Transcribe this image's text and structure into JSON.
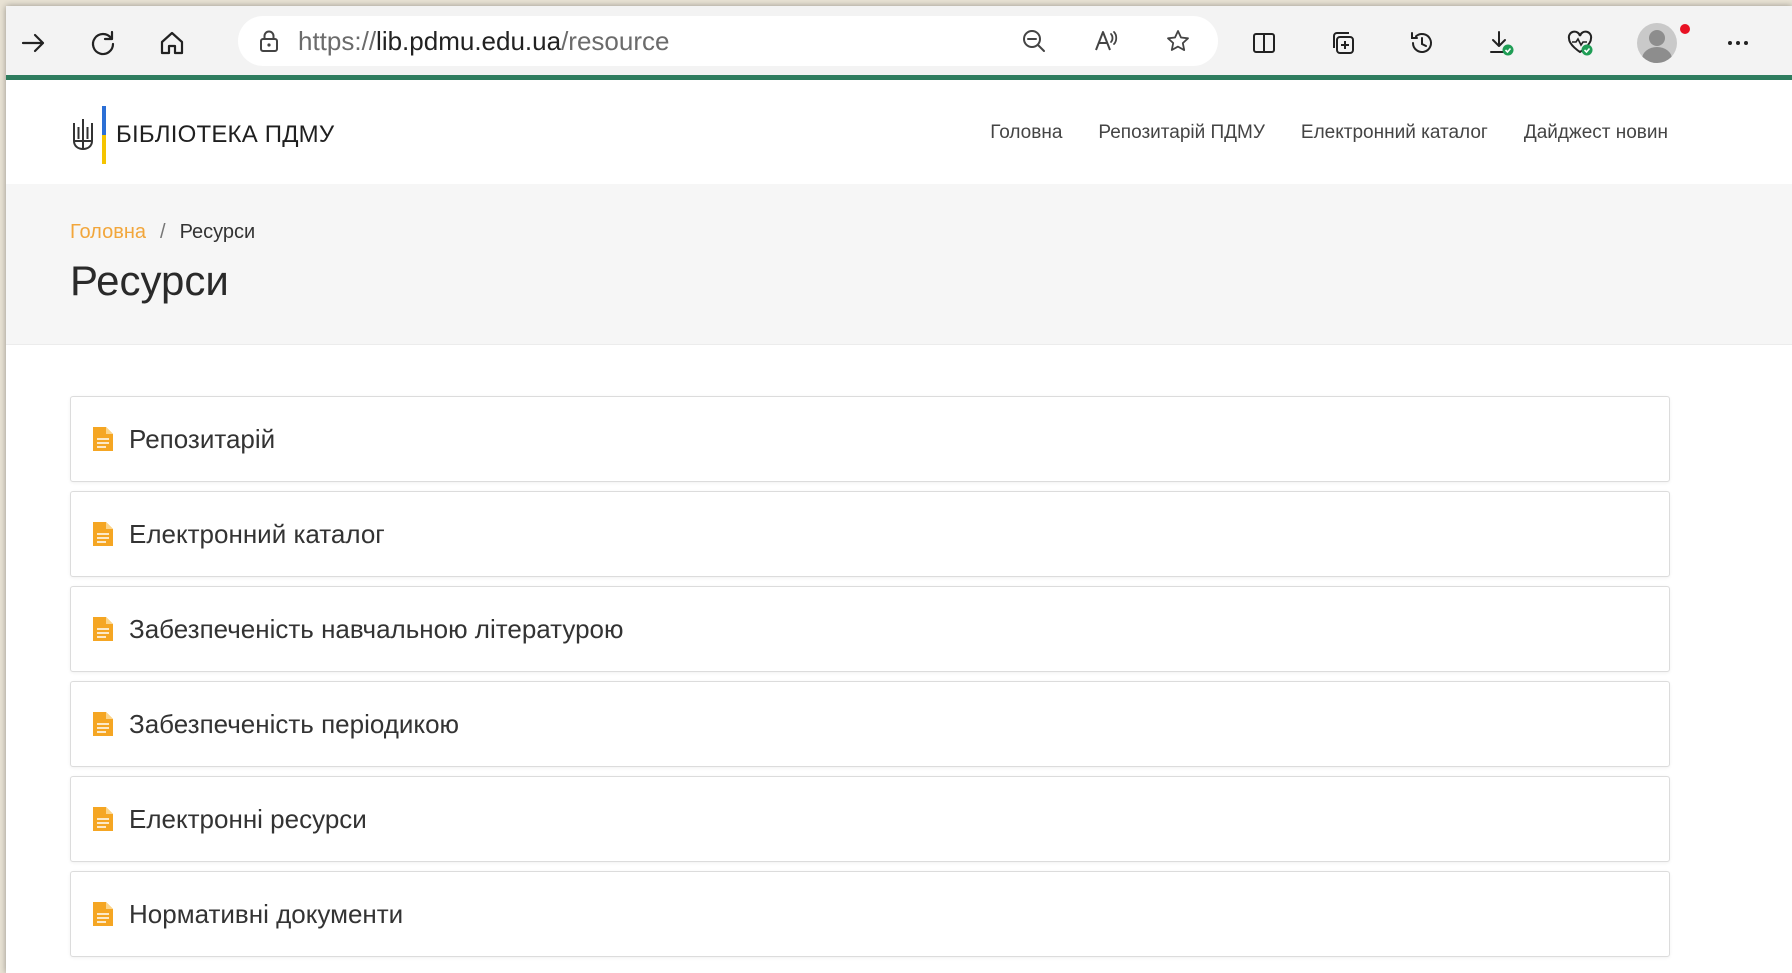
{
  "browser": {
    "url_proto": "https://",
    "url_host": "lib.pdmu.edu.ua",
    "url_path": "/resource"
  },
  "site": {
    "logo_text": "БІБЛІОТЕКА ПДМУ",
    "nav": [
      "Головна",
      "Репозитарій ПДМУ",
      "Електронний каталог",
      "Дайджест новин"
    ]
  },
  "breadcrumb": {
    "home": "Головна",
    "separator": "/",
    "current": "Ресурси"
  },
  "page": {
    "title": "Ресурси"
  },
  "resources": [
    "Репозитарій",
    "Електронний каталог",
    "Забезпеченість навчальною літературою",
    "Забезпеченість періодикою",
    "Електронні ресурси",
    "Нормативні документи"
  ],
  "colors": {
    "accent": "#f2a63b",
    "toolbar_border": "#2f7d5f",
    "doc_icon": "#f5a623"
  }
}
